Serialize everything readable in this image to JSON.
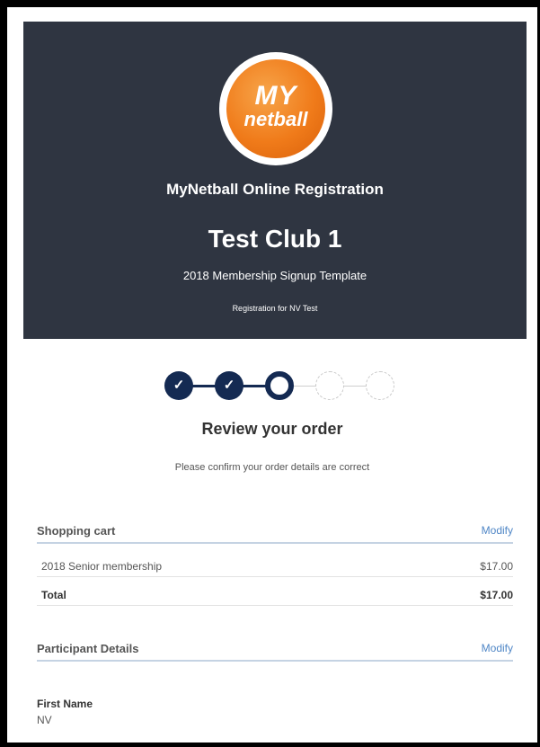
{
  "header": {
    "logo_top": "MY",
    "logo_bottom": "netball",
    "registration_title": "MyNetball Online Registration",
    "club_name": "Test Club 1",
    "template_name": "2018 Membership Signup Template",
    "registration_for": "Registration for NV Test"
  },
  "progress": {
    "total_steps": 5,
    "completed_steps": 2,
    "current_step": 3,
    "check_glyph": "✓",
    "icon": "check-icon"
  },
  "review": {
    "title": "Review your order",
    "subtitle": "Please confirm your order details are correct"
  },
  "shopping_cart": {
    "title": "Shopping cart",
    "modify_label": "Modify",
    "items": [
      {
        "name": "2018 Senior membership",
        "price": "$17.00"
      }
    ],
    "total_label": "Total",
    "total_value": "$17.00"
  },
  "participant": {
    "title": "Participant Details",
    "modify_label": "Modify",
    "first_name_label": "First Name",
    "first_name_value": "NV"
  },
  "colors": {
    "header_bg": "#2f3541",
    "step_active": "#142a52",
    "link": "#4f86c6",
    "logo_orange": "#f07b1a"
  }
}
